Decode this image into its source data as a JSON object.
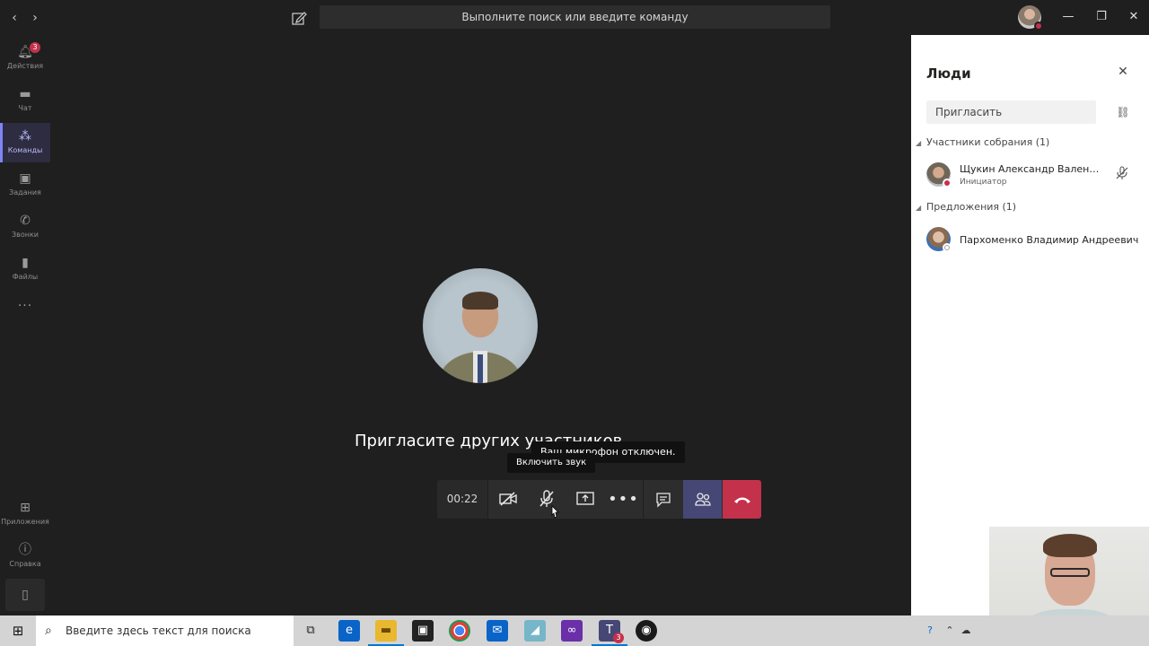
{
  "titlebar": {
    "search_placeholder": "Выполните поиск или введите команду"
  },
  "rail": {
    "items": [
      {
        "label": "Действия",
        "badge": "3"
      },
      {
        "label": "Чат"
      },
      {
        "label": "Команды"
      },
      {
        "label": "Задания"
      },
      {
        "label": "Звонки"
      },
      {
        "label": "Файлы"
      }
    ],
    "more": "...",
    "bottom": [
      {
        "label": "Приложения"
      },
      {
        "label": "Справка"
      }
    ]
  },
  "stage": {
    "invite_text": "Пригласите других участников",
    "tooltip_mic_off": "Ваш микрофон отключен.",
    "tooltip_unmute": "Включить звук"
  },
  "callbar": {
    "timer": "00:22"
  },
  "panel": {
    "title": "Люди",
    "invite_placeholder": "Пригласить",
    "section_participants": "Участники собрания (1)",
    "section_suggestions": "Предложения (1)",
    "participants": [
      {
        "name": "Щукин Александр Валенти...",
        "role": "Инициатор"
      }
    ],
    "suggestions": [
      {
        "name": "Пархоменко Владимир Андреевич"
      }
    ]
  },
  "taskbar": {
    "search_placeholder": "Введите здесь текст для поиска",
    "teams_badge": "3"
  },
  "colors": {
    "accent": "#7f85f5",
    "hangup": "#c4314b",
    "people_active": "#464775",
    "background": "#1f1f1f"
  }
}
